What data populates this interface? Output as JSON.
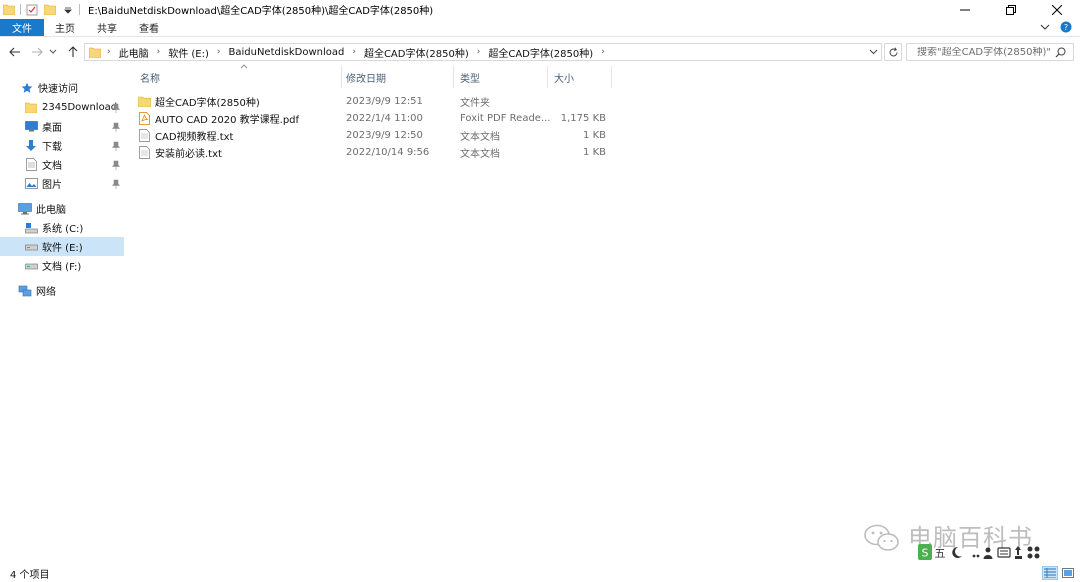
{
  "window": {
    "title": "E:\\BaiduNetdiskDownload\\超全CAD字体(2850种)\\超全CAD字体(2850种)"
  },
  "ribbon": {
    "tabs": [
      "文件",
      "主页",
      "共享",
      "查看"
    ]
  },
  "address": {
    "crumbs": [
      "此电脑",
      "软件 (E:)",
      "BaiduNetdiskDownload",
      "超全CAD字体(2850种)",
      "超全CAD字体(2850种)"
    ]
  },
  "search": {
    "placeholder": "搜索\"超全CAD字体(2850种)\""
  },
  "sidebar": {
    "quick_access": "快速访问",
    "pinned": [
      "2345Download",
      "桌面",
      "下载",
      "文档",
      "图片"
    ],
    "this_pc": "此电脑",
    "drives": [
      "系统 (C:)",
      "软件 (E:)",
      "文档 (F:)"
    ],
    "network": "网络"
  },
  "columns": {
    "name": "名称",
    "date": "修改日期",
    "type": "类型",
    "size": "大小"
  },
  "files": [
    {
      "name": "超全CAD字体(2850种)",
      "date": "2023/9/9 12:51",
      "type": "文件夹",
      "size": "",
      "icon": "folder-icon"
    },
    {
      "name": "AUTO  CAD 2020 教学课程.pdf",
      "date": "2022/1/4 11:00",
      "type": "Foxit PDF Reade...",
      "size": "1,175 KB",
      "icon": "pdf-file-icon"
    },
    {
      "name": "CAD视频教程.txt",
      "date": "2023/9/9 12:50",
      "type": "文本文档",
      "size": "1 KB",
      "icon": "text-file-icon"
    },
    {
      "name": "安装前必读.txt",
      "date": "2022/10/14 9:56",
      "type": "文本文档",
      "size": "1 KB",
      "icon": "text-file-icon"
    }
  ],
  "status": {
    "item_count": "4 个项目"
  },
  "watermark": {
    "text": "电脑百科书"
  },
  "colors": {
    "accent": "#1979ca",
    "selection": "#cce4f7",
    "folder": "#f8d775"
  }
}
